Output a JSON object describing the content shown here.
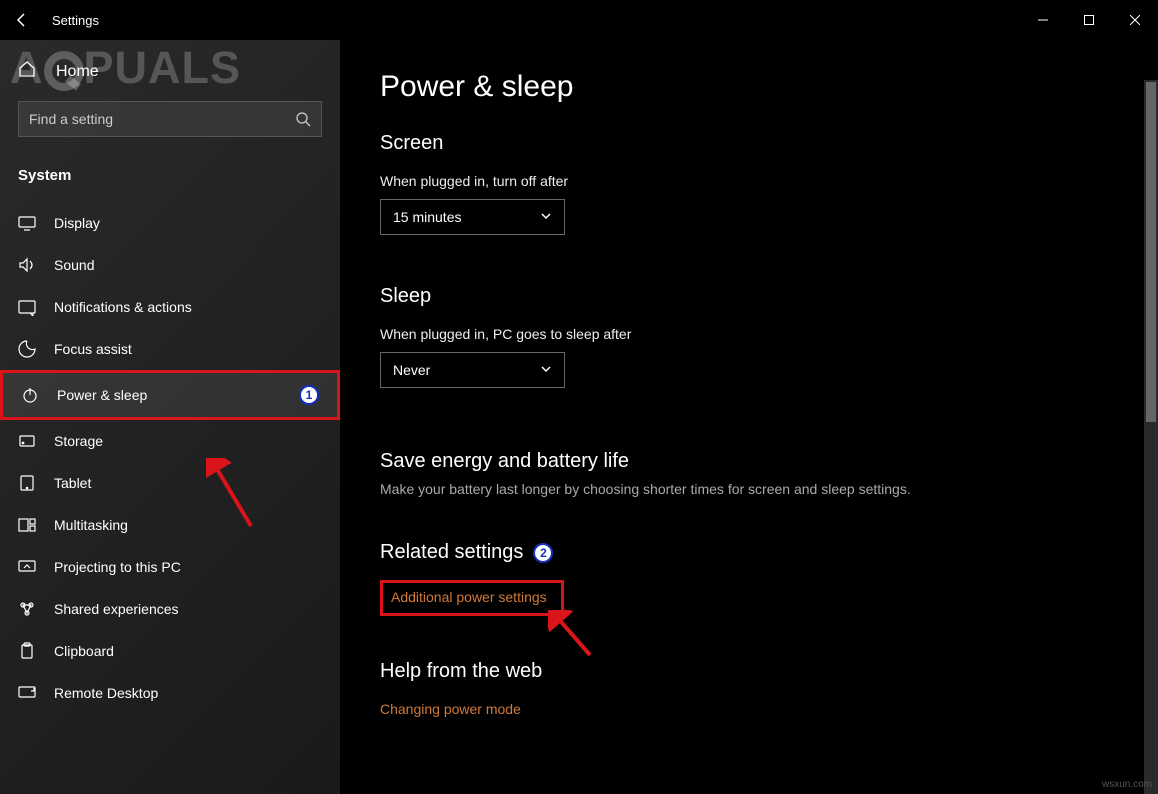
{
  "titlebar": {
    "title": "Settings"
  },
  "sidebar": {
    "home": "Home",
    "search_placeholder": "Find a setting",
    "category": "System",
    "items": [
      {
        "label": "Display"
      },
      {
        "label": "Sound"
      },
      {
        "label": "Notifications & actions"
      },
      {
        "label": "Focus assist"
      },
      {
        "label": "Power & sleep"
      },
      {
        "label": "Storage"
      },
      {
        "label": "Tablet"
      },
      {
        "label": "Multitasking"
      },
      {
        "label": "Projecting to this PC"
      },
      {
        "label": "Shared experiences"
      },
      {
        "label": "Clipboard"
      },
      {
        "label": "Remote Desktop"
      }
    ]
  },
  "main": {
    "title": "Power & sleep",
    "screen": {
      "heading": "Screen",
      "label": "When plugged in, turn off after",
      "value": "15 minutes"
    },
    "sleep": {
      "heading": "Sleep",
      "label": "When plugged in, PC goes to sleep after",
      "value": "Never"
    },
    "battery": {
      "heading": "Save energy and battery life",
      "desc": "Make your battery last longer by choosing shorter times for screen and sleep settings."
    },
    "related": {
      "heading": "Related settings",
      "link": "Additional power settings"
    },
    "help": {
      "heading": "Help from the web",
      "link": "Changing power mode"
    }
  },
  "annotations": {
    "marker1": "1",
    "marker2": "2"
  },
  "watermark": "A  PUALS",
  "credit": "wsxun.com"
}
